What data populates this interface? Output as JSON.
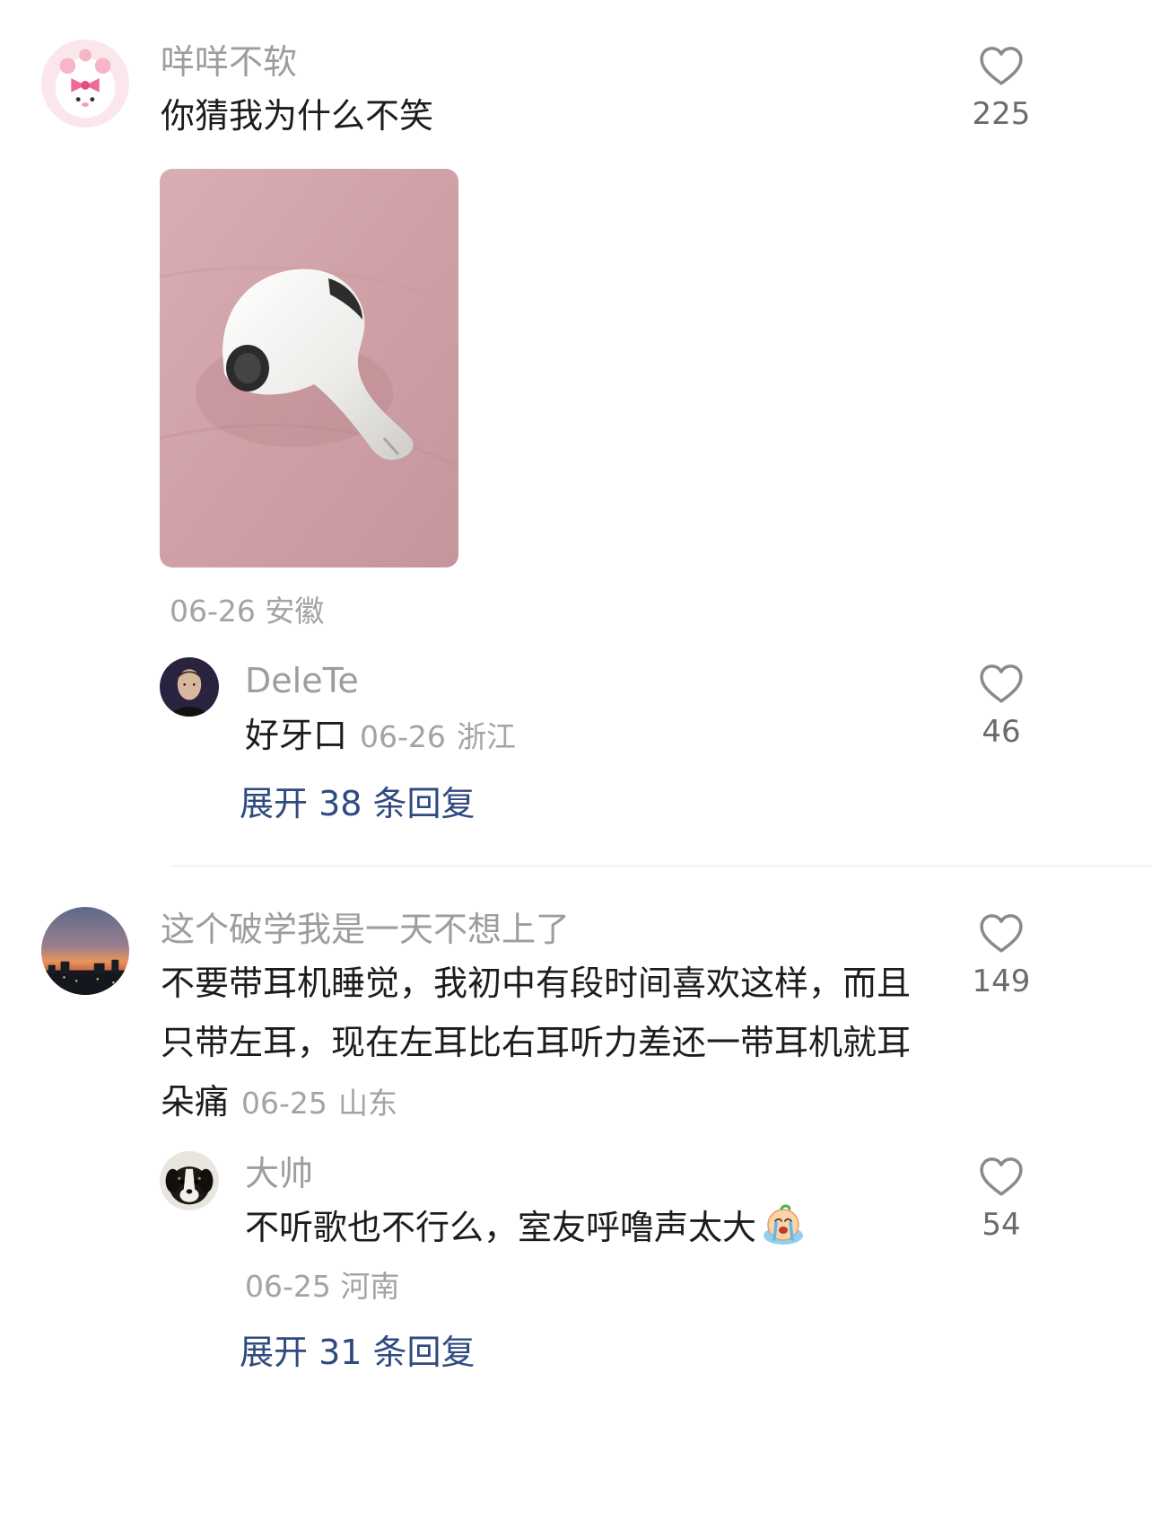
{
  "comments": [
    {
      "username": "咩咩不软",
      "text": "你猜我为什么不笑",
      "likes": "225",
      "date": "06-26",
      "location": "安徽",
      "avatar_icon": "pink-bunny-avatar-icon",
      "image_icon": "airpod-on-pink-fabric-photo",
      "reply": {
        "username": "DeleTe",
        "text": "好牙口",
        "date": "06-26",
        "location": "浙江",
        "likes": "46",
        "avatar_icon": "man-portrait-avatar-icon"
      },
      "expand_label": "展开 38 条回复"
    },
    {
      "username": "这个破学我是一天不想上了",
      "text": "不要带耳机睡觉，我初中有段时间喜欢这样，而且只带左耳，现在左耳比右耳听力差还一带耳机就耳朵痛",
      "likes": "149",
      "date": "06-25",
      "location": "山东",
      "avatar_icon": "sunset-city-avatar-icon",
      "reply": {
        "username": "大帅",
        "text": "不听歌也不行么，室友呼噜声太大",
        "date": "06-25",
        "location": "河南",
        "likes": "54",
        "avatar_icon": "puppy-avatar-icon",
        "emoji_icon": "crying-emoji-icon"
      },
      "expand_label": "展开 31 条回复"
    }
  ],
  "colors": {
    "username": "#9d9d9d",
    "text": "#1c1c1c",
    "meta": "#a3a3a3",
    "expand_link": "#2f4a80",
    "like_icon": "#8a8a8a"
  }
}
